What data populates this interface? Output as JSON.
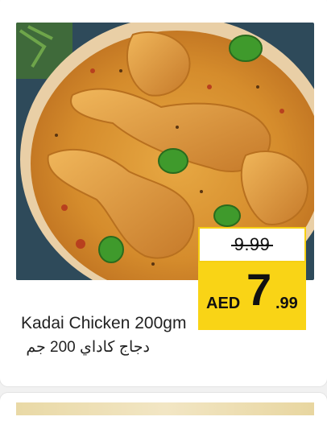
{
  "product": {
    "image_name": "kadai-chicken-curry",
    "old_price": "9.99",
    "currency": "AED",
    "price_int": "7",
    "price_dec": ".99",
    "title_en": "Kadai Chicken 200gm",
    "title_ar": "دجاج كاداي 200 جم"
  },
  "colors": {
    "price_band": "#f9d416",
    "curry": "#d08a2c",
    "bowl": "#e8c9a0"
  }
}
